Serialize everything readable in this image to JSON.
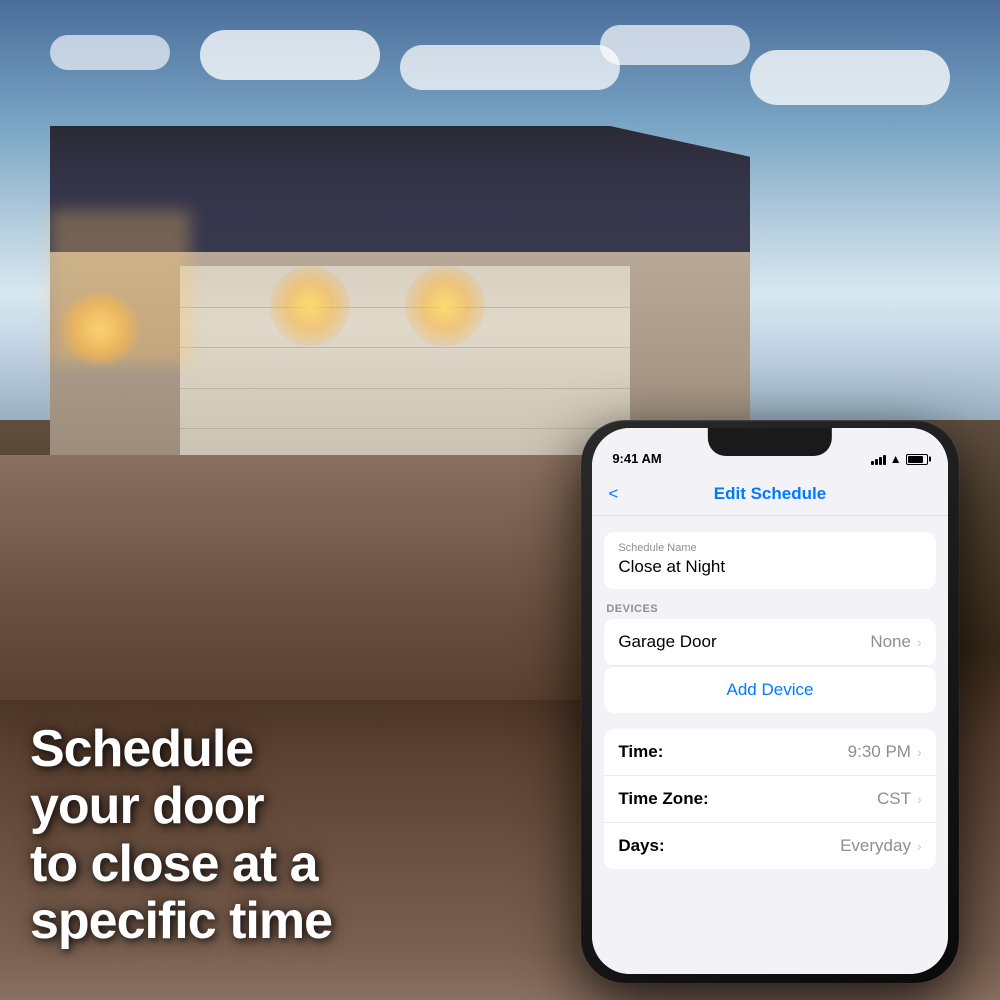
{
  "background": {
    "alt": "Modern house with open garage door at night with lights"
  },
  "overlay_text": {
    "line1": "Schedule",
    "line2": "your door",
    "line3": "to close at a",
    "line4": "specific time"
  },
  "phone": {
    "status_bar": {
      "time": "9:41 AM",
      "signal": "signal",
      "wifi": "wifi",
      "battery": "battery"
    },
    "nav": {
      "back_label": "<",
      "title": "Edit Schedule"
    },
    "schedule_name_label": "Schedule Name",
    "schedule_name_value": "Close at Night",
    "devices_section_header": "DEVICES",
    "device_name": "Garage Door",
    "device_status": "None",
    "add_device_label": "Add Device",
    "settings": [
      {
        "label": "Time:",
        "value": "9:30 PM"
      },
      {
        "label": "Time Zone:",
        "value": "CST"
      },
      {
        "label": "Days:",
        "value": "Everyday"
      }
    ]
  }
}
